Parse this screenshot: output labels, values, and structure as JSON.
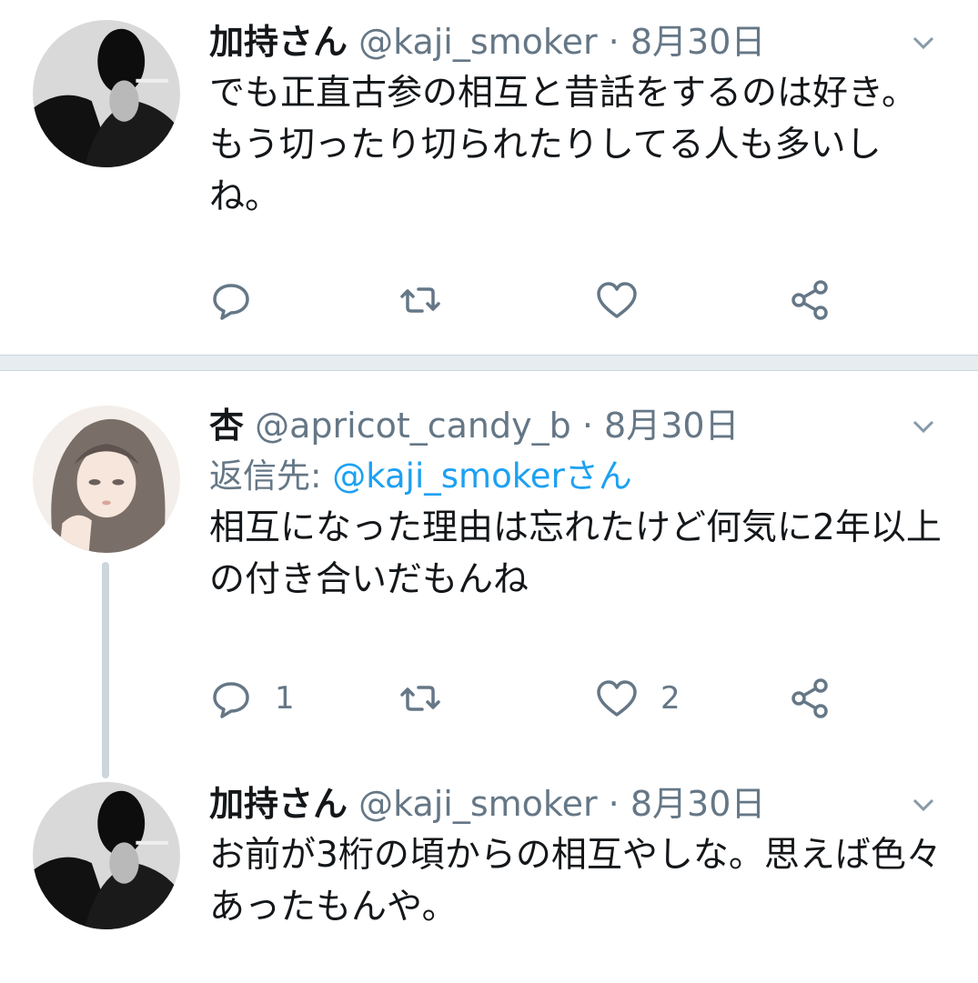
{
  "tweets": [
    {
      "name": "加持さん",
      "handle": "@kaji_smoker",
      "dot": "·",
      "date": "8月30日",
      "text": "でも正直古参の相互と昔話をするのは好き。もう切ったり切られたりしてる人も多いしね。",
      "reply_count": "",
      "like_count": ""
    },
    {
      "name": "杏",
      "handle": "@apricot_candy_b",
      "dot": "·",
      "date": "8月30日",
      "reply_prefix": "返信先: ",
      "reply_mention": "@kaji_smokerさん",
      "text": "相互になった理由は忘れたけど何気に2年以上の付き合いだもんね",
      "reply_count": "1",
      "like_count": "2"
    },
    {
      "name": "加持さん",
      "handle": "@kaji_smoker",
      "dot": "·",
      "date": "8月30日",
      "text": "お前が3桁の頃からの相互やしな。思えば色々あったもんや。"
    }
  ],
  "icons": {
    "reply": "reply-icon",
    "retweet": "retweet-icon",
    "like": "like-icon",
    "share": "share-icon",
    "caret": "chevron-down-icon"
  },
  "colors": {
    "text": "#14171a",
    "secondary": "#657786",
    "link": "#1da1f2",
    "divider": "#e6ecf0"
  }
}
